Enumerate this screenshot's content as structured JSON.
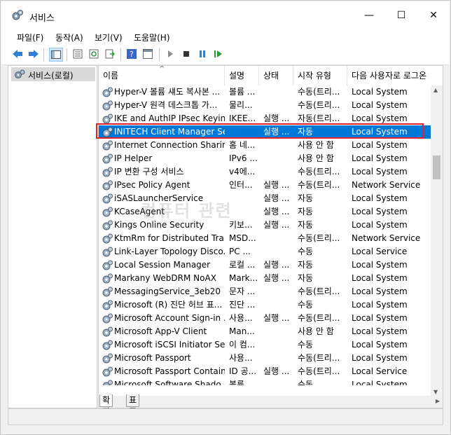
{
  "window": {
    "title": "서비스"
  },
  "menu": [
    "파일(F)",
    "동작(A)",
    "보기(V)",
    "도움말(H)"
  ],
  "toolbar_icons": [
    "back-arrow-icon",
    "forward-arrow-icon",
    "show-tree-icon",
    "properties-icon",
    "refresh-icon",
    "export-icon",
    "help-icon",
    "console-icon",
    "start-icon",
    "stop-icon",
    "pause-icon",
    "restart-icon"
  ],
  "tree": {
    "root_label": "서비스(로컬)"
  },
  "columns": [
    "이름",
    "설명",
    "상태",
    "시작 유형",
    "다음 사용자로 로그온"
  ],
  "rows": [
    {
      "name": "Hyper-V 볼륨 섀도 복사본 ...",
      "desc": "볼륨 ...",
      "status": "",
      "type": "수동(트리...",
      "logon": "Local System"
    },
    {
      "name": "Hyper-V 원격 데스크톱 가...",
      "desc": "물리...",
      "status": "",
      "type": "수동(트리...",
      "logon": "Local System"
    },
    {
      "name": "IKE and AuthIP IPsec Keyin...",
      "desc": "IKEE...",
      "status": "실행 ...",
      "type": "자동(트리...",
      "logon": "Local System"
    },
    {
      "name": "INITECH Client Manager Se...",
      "desc": "",
      "status": "실행 ...",
      "type": "자동",
      "logon": "Local System",
      "selected": true
    },
    {
      "name": "Internet Connection Sharin...",
      "desc": "홈 네...",
      "status": "",
      "type": "사용 안 함",
      "logon": "Local System"
    },
    {
      "name": "IP Helper",
      "desc": "IPv6 ...",
      "status": "",
      "type": "사용 안 함",
      "logon": "Local System"
    },
    {
      "name": "IP 변환 구성 서비스",
      "desc": "v4에...",
      "status": "",
      "type": "수동(트리...",
      "logon": "Local System"
    },
    {
      "name": "IPsec Policy Agent",
      "desc": "인터...",
      "status": "실행 ...",
      "type": "수동(트리...",
      "logon": "Network Service"
    },
    {
      "name": "iSASLauncherService",
      "desc": "",
      "status": "실행 ...",
      "type": "자동",
      "logon": "Local System"
    },
    {
      "name": "KCaseAgent",
      "desc": "",
      "status": "실행 ...",
      "type": "자동",
      "logon": "Local System"
    },
    {
      "name": "Kings Online Security",
      "desc": "키보...",
      "status": "실행 ...",
      "type": "자동",
      "logon": "Local System"
    },
    {
      "name": "KtmRm for Distributed Tra...",
      "desc": "MSD...",
      "status": "",
      "type": "수동(트리...",
      "logon": "Network Service"
    },
    {
      "name": "Link-Layer Topology Disco...",
      "desc": "PC ...",
      "status": "",
      "type": "수동",
      "logon": "Local Service"
    },
    {
      "name": "Local Session Manager",
      "desc": "로컬 ...",
      "status": "실행 ...",
      "type": "자동",
      "logon": "Local System"
    },
    {
      "name": "Markany WebDRM NoAX",
      "desc": "Mark...",
      "status": "실행 ...",
      "type": "자동",
      "logon": "Local System"
    },
    {
      "name": "MessagingService_3eb20",
      "desc": "문자 ...",
      "status": "",
      "type": "수동(트리...",
      "logon": "Local System"
    },
    {
      "name": "Microsoft (R) 진단 허브 표...",
      "desc": "진단 ...",
      "status": "",
      "type": "수동",
      "logon": "Local System"
    },
    {
      "name": "Microsoft Account Sign-in ...",
      "desc": "사용...",
      "status": "실행 ...",
      "type": "수동(트리...",
      "logon": "Local System"
    },
    {
      "name": "Microsoft App-V Client",
      "desc": "Man...",
      "status": "",
      "type": "사용 안 함",
      "logon": "Local System"
    },
    {
      "name": "Microsoft iSCSI Initiator Se...",
      "desc": "이 컴...",
      "status": "",
      "type": "수동",
      "logon": "Local System"
    },
    {
      "name": "Microsoft Passport",
      "desc": "사용...",
      "status": "",
      "type": "수동(트리...",
      "logon": "Local System"
    },
    {
      "name": "Microsoft Passport Container",
      "desc": "ID 공...",
      "status": "실행 ...",
      "type": "수동(트리...",
      "logon": "Local Service"
    },
    {
      "name": "Microsoft Software Shado...",
      "desc": "볼륨 ...",
      "status": "",
      "type": "수동",
      "logon": "Local System"
    }
  ],
  "tabs": [
    "확장",
    "표준"
  ],
  "watermark": "컴퓨터 관련",
  "colors": {
    "selection": "#0078d7",
    "highlight_border": "#e0222b"
  }
}
